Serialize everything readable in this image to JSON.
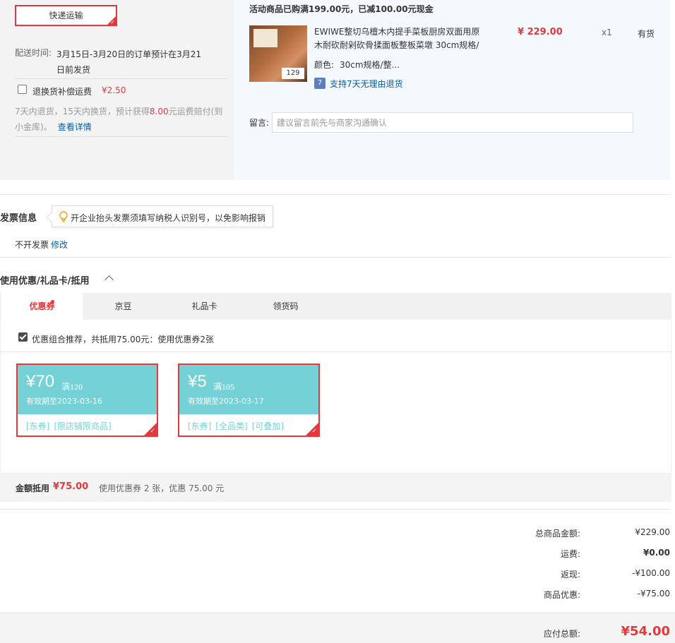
{
  "shipping": {
    "method": "快递运输",
    "time_label": "配送时间:",
    "time_value": "3月15日-3月20日的订单预计在3月21日前发货",
    "return_label": "退换货补偿运费",
    "return_price": "¥2.50",
    "return_desc_1": "7天内退货，15天内换货，预计获得",
    "return_desc_amount": "8.00",
    "return_desc_2": "元运费赔付(到小金库)。",
    "return_link": "查看详情"
  },
  "product": {
    "promo": "活动商品已购满199.00元，已减100.00元现金",
    "image_price": "129",
    "title": "EWIWE整切乌檀木内提手菜板厨房双面用原木耐砍耐剁砍骨揉面板整板菜墩 30cm规格/",
    "price": "¥ 229.00",
    "qty": "x1",
    "stock": "有货",
    "color_label": "颜色:",
    "color_value": "30cm规格/整...",
    "return_badge": "7",
    "return_text": "支持7天无理由退货",
    "message_label": "留言:",
    "message_placeholder": "建议留言前先与商家沟通确认"
  },
  "invoice": {
    "title": "发票信息",
    "tip": "开企业抬头发票须填写纳税人识别号，以免影响报销",
    "value": "不开发票",
    "edit": "修改"
  },
  "coupons": {
    "title": "使用优惠/礼品卡/抵用",
    "tabs": [
      "优惠券",
      "京豆",
      "礼品卡",
      "领货码"
    ],
    "recommend": "优惠组合推荐，共抵用75.00元：使用优惠券2张",
    "items": [
      {
        "amount": "¥70",
        "cond": "满120",
        "expiry": "有效期至2023-03-16",
        "tags": [
          "[东券]",
          "[限店铺限商品]"
        ]
      },
      {
        "amount": "¥5",
        "cond": "满105",
        "expiry": "有效期至2023-03-17",
        "tags": [
          "[东券]",
          "[全品类]",
          "[可叠加]"
        ]
      }
    ],
    "summary_label": "金额抵用",
    "summary_amount": "¥75.00",
    "summary_desc": "使用优惠券 2 张，优惠 75.00 元"
  },
  "totals": {
    "rows": [
      {
        "label": "总商品金额:",
        "value": "¥229.00"
      },
      {
        "label": "运费:",
        "value": "¥0.00"
      },
      {
        "label": "返现:",
        "value": "-¥100.00"
      },
      {
        "label": "商品优惠:",
        "value": "-¥75.00"
      }
    ],
    "final_label": "应付总额:",
    "final_value": "¥54.00"
  },
  "colors": {
    "accent": "#e4393c",
    "coupon": "#74d2d6",
    "link": "#005ea7"
  }
}
